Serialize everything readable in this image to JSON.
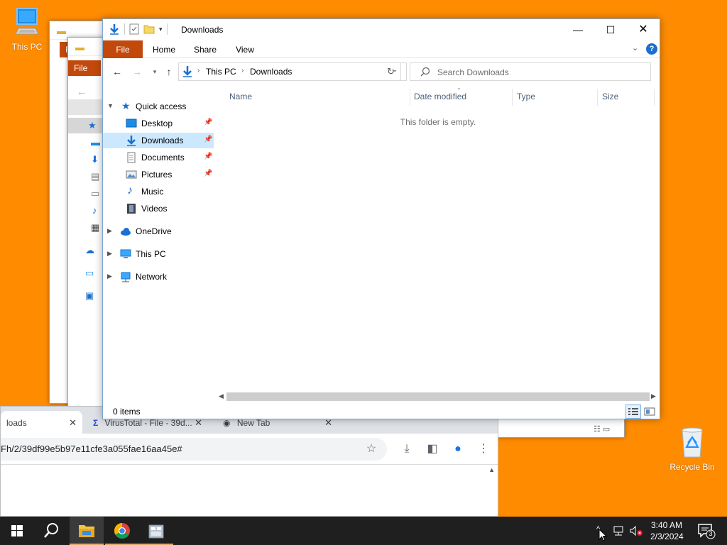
{
  "desktop": {
    "this_pc_label": "This PC",
    "recycle_bin_label": "Recycle Bin"
  },
  "bg_explorer": {
    "file_tab": "File",
    "file_tab_short": "F"
  },
  "chrome": {
    "active_tab_title": "loads",
    "tab2_title": "VirusTotal - File - 39d...",
    "tab3_title": "New Tab",
    "address": "Fh/2/39df99e5b97e11cfe3a055fae16aa45e#"
  },
  "explorer": {
    "title": "Downloads",
    "ribbon": {
      "file": "File",
      "home": "Home",
      "share": "Share",
      "view": "View"
    },
    "breadcrumb": [
      "This PC",
      "Downloads"
    ],
    "search_placeholder": "Search Downloads",
    "nav": {
      "quick_access": "Quick access",
      "quick_items": [
        {
          "label": "Desktop",
          "pinned": true
        },
        {
          "label": "Downloads",
          "pinned": true,
          "selected": true
        },
        {
          "label": "Documents",
          "pinned": true
        },
        {
          "label": "Pictures",
          "pinned": true
        },
        {
          "label": "Music",
          "pinned": false
        },
        {
          "label": "Videos",
          "pinned": false
        }
      ],
      "onedrive": "OneDrive",
      "this_pc": "This PC",
      "network": "Network"
    },
    "columns": [
      "Name",
      "Date modified",
      "Type",
      "Size"
    ],
    "empty_message": "This folder is empty.",
    "status": "0 items"
  },
  "taskbar": {
    "time": "3:40 AM",
    "date": "2/3/2024",
    "notification_count": "3"
  },
  "colors": {
    "desktop": "#ff8c00",
    "ribbon_file": "#c1490c",
    "selection": "#cce8ff",
    "taskbar": "#1f1f1f"
  }
}
